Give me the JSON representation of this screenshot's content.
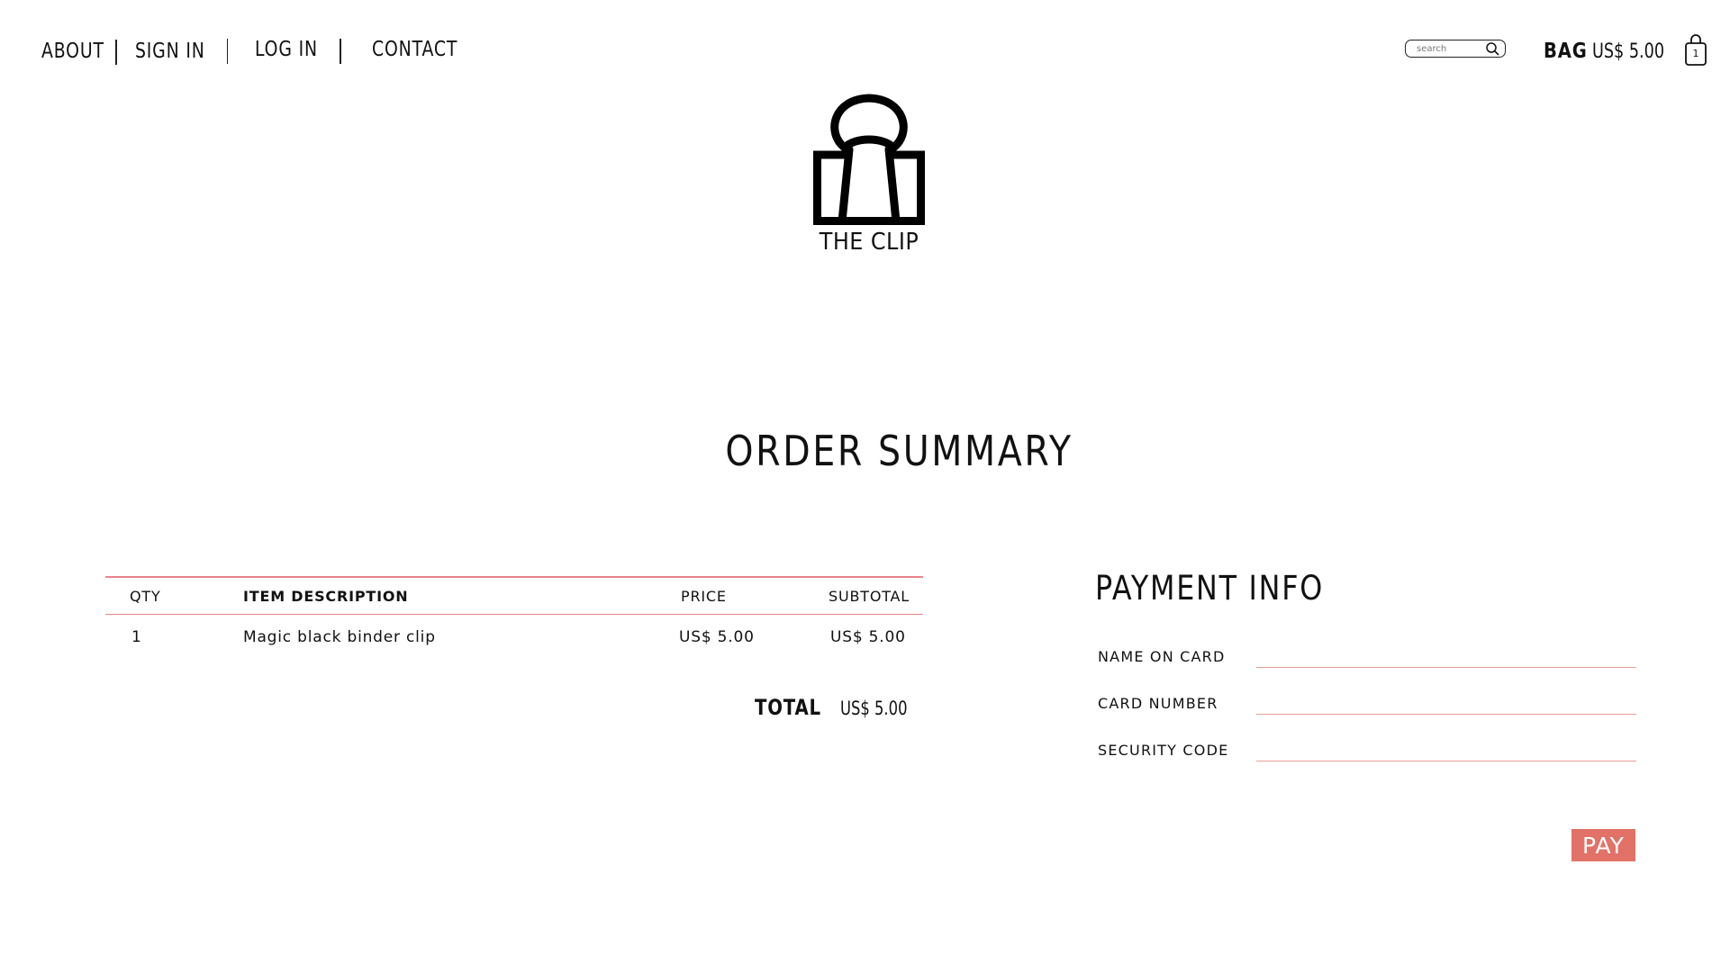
{
  "nav": {
    "about": "ABOUT",
    "sign_in": "SIGN IN",
    "log_in": "LOG IN",
    "contact": "CONTACT"
  },
  "search": {
    "placeholder": "search",
    "value": ""
  },
  "bag": {
    "label": "BAG",
    "total": "US$ 5.00",
    "count": "1"
  },
  "brand": {
    "name": "THE CLIP",
    "logo_icon": "binder-clip-icon"
  },
  "page_title": "ORDER SUMMARY",
  "order": {
    "columns": {
      "qty": "QTY",
      "description": "ITEM DESCRIPTION",
      "price": "PRICE",
      "subtotal": "SUBTOTAL"
    },
    "rows": [
      {
        "qty": "1",
        "description": "Magic black binder clip",
        "price": "US$ 5.00",
        "subtotal": "US$ 5.00"
      }
    ],
    "total_label": "TOTAL",
    "total_value": "US$ 5.00"
  },
  "payment": {
    "title": "PAYMENT INFO",
    "fields": {
      "name_on_card": {
        "label": "NAME ON CARD",
        "value": ""
      },
      "card_number": {
        "label": "CARD NUMBER",
        "value": ""
      },
      "security_code": {
        "label": "SECURITY CODE",
        "value": ""
      }
    },
    "pay_label": "PAY"
  },
  "colors": {
    "accent": "#e27267",
    "rule": "#e8848a",
    "text": "#111111",
    "background": "#ffffff"
  }
}
